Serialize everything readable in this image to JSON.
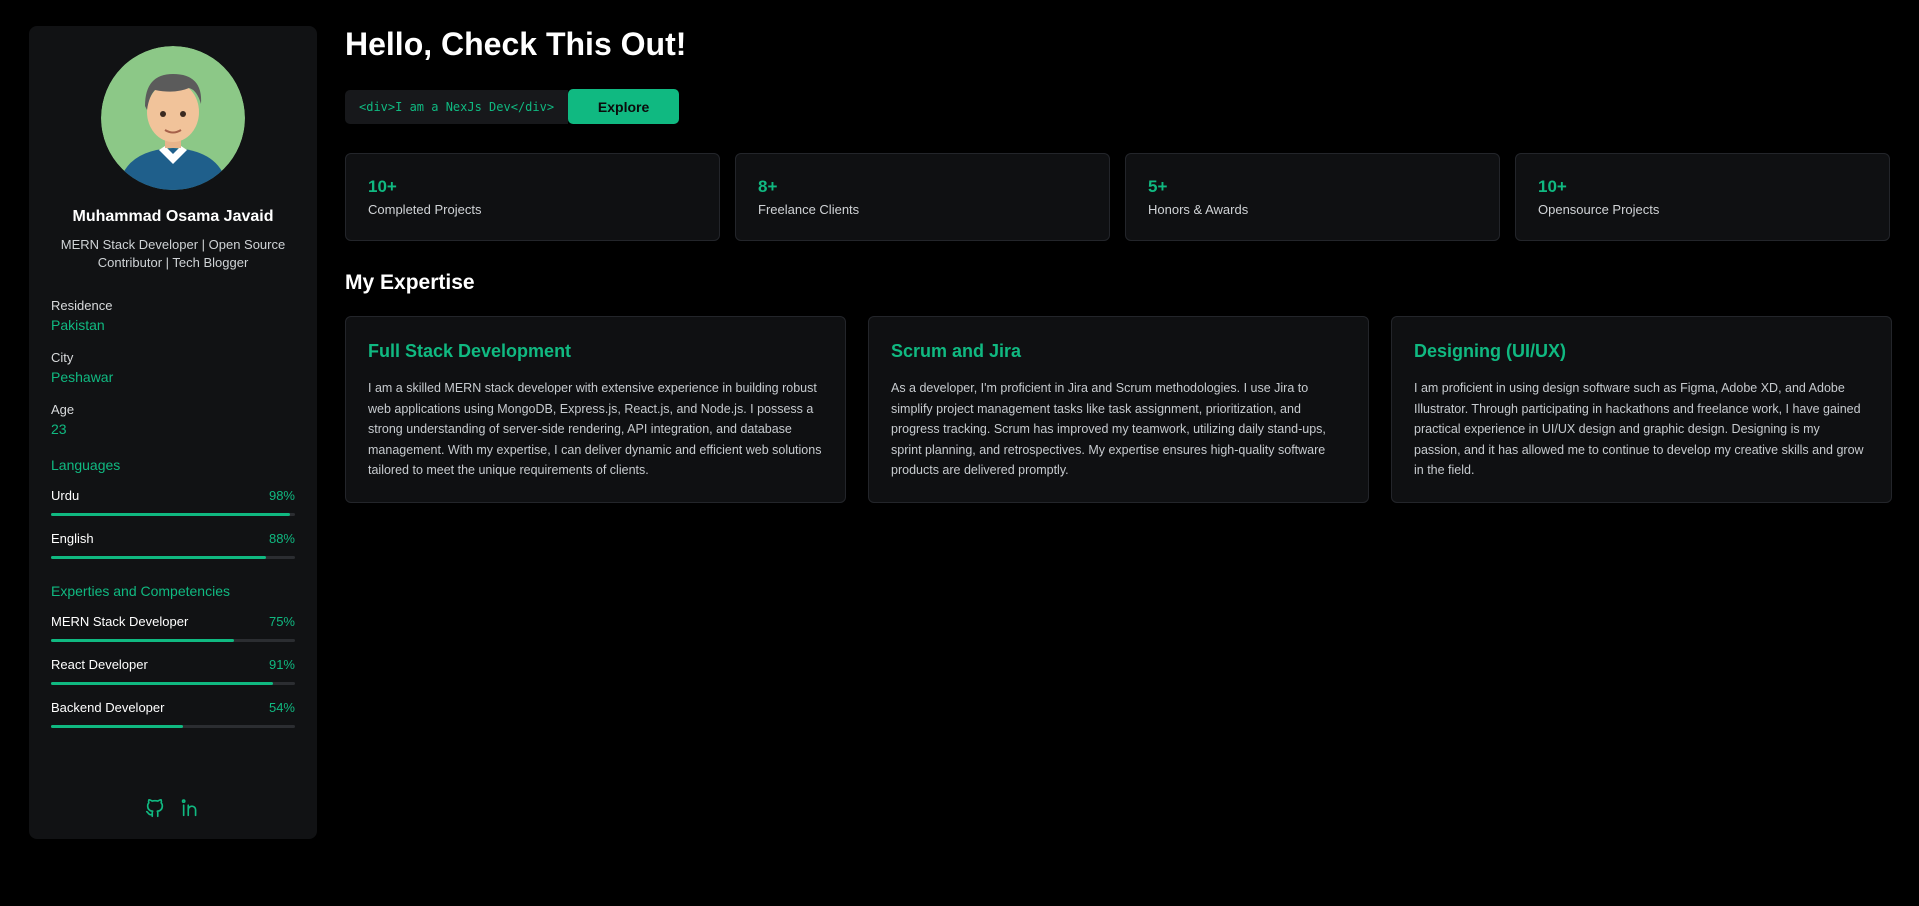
{
  "profile": {
    "name": "Muhammad Osama Javaid",
    "title": "MERN Stack Developer | Open Source Contributor | Tech Blogger"
  },
  "info": [
    {
      "label": "Residence",
      "value": "Pakistan"
    },
    {
      "label": "City",
      "value": "Peshawar"
    },
    {
      "label": "Age",
      "value": "23"
    }
  ],
  "languages": {
    "title": "Languages",
    "items": [
      {
        "name": "Urdu",
        "percent": "98%",
        "level": 98
      },
      {
        "name": "English",
        "percent": "88%",
        "level": 88
      }
    ]
  },
  "competencies": {
    "title": "Experties and Competencies",
    "items": [
      {
        "name": "MERN Stack Developer",
        "percent": "75%",
        "level": 75
      },
      {
        "name": "React Developer",
        "percent": "91%",
        "level": 91
      },
      {
        "name": "Backend Developer",
        "percent": "54%",
        "level": 54
      }
    ]
  },
  "socials": [
    "github-icon",
    "linkedin-icon"
  ],
  "main": {
    "heading": "Hello, Check This Out!",
    "code_text": "<div>I am a NexJs Dev</div>",
    "explore_label": "Explore",
    "stats": [
      {
        "value": "10+",
        "label": "Completed Projects"
      },
      {
        "value": "8+",
        "label": "Freelance Clients"
      },
      {
        "value": "5+",
        "label": "Honors & Awards"
      },
      {
        "value": "10+",
        "label": "Opensource Projects"
      }
    ],
    "expertise_title": "My Expertise",
    "cards": [
      {
        "title": "Full Stack Development",
        "text": "I am a skilled MERN stack developer with extensive experience in building robust web applications using MongoDB, Express.js, React.js, and Node.js. I possess a strong understanding of server-side rendering, API integration, and database management. With my expertise, I can deliver dynamic and efficient web solutions tailored to meet the unique requirements of clients."
      },
      {
        "title": "Scrum and Jira",
        "text": "As a developer, I'm proficient in Jira and Scrum methodologies. I use Jira to simplify project management tasks like task assignment, prioritization, and progress tracking. Scrum has improved my teamwork, utilizing daily stand-ups, sprint planning, and retrospectives. My expertise ensures high-quality software products are delivered promptly."
      },
      {
        "title": "Designing (UI/UX)",
        "text": "I am proficient in using design software such as Figma, Adobe XD, and Adobe Illustrator. Through participating in hackathons and freelance work, I have gained practical experience in UI/UX design and graphic design. Designing is my passion, and it has allowed me to continue to develop my creative skills and grow in the field."
      }
    ]
  },
  "colors": {
    "accent": "#10b981",
    "background": "#000000",
    "panel": "#111214"
  }
}
